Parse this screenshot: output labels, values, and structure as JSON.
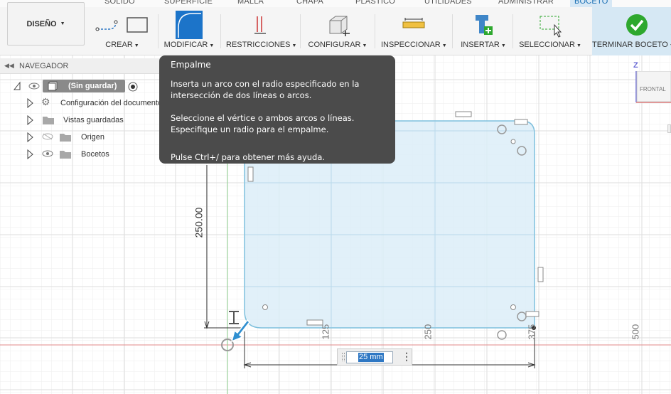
{
  "tabs": [
    {
      "label": "SÓLIDO"
    },
    {
      "label": "SUPERFICIE"
    },
    {
      "label": "MALLA"
    },
    {
      "label": "CHAPA"
    },
    {
      "label": "PLÁSTICO"
    },
    {
      "label": "UTILIDADES"
    },
    {
      "label": "ADMINISTRAR"
    },
    {
      "label": "BOCETO"
    }
  ],
  "toolbar": {
    "workspace": "DISEÑO",
    "groups": [
      {
        "label": "CREAR",
        "icon": "sketch-line-rectangle-icon"
      },
      {
        "label": "MODIFICAR",
        "icon": "fillet-icon"
      },
      {
        "label": "RESTRICCIONES",
        "icon": "constraint-icon"
      },
      {
        "label": "CONFIGURAR",
        "icon": "configure-icon"
      },
      {
        "label": "INSPECCIONAR",
        "icon": "measure-icon"
      },
      {
        "label": "INSERTAR",
        "icon": "insert-icon"
      },
      {
        "label": "SELECCIONAR",
        "icon": "select-icon"
      },
      {
        "label": "TERMINAR BOCETO",
        "icon": "finish-sketch-icon"
      }
    ]
  },
  "navigator": {
    "title": "NAVEGADOR",
    "root": "(Sin guardar)",
    "items": [
      {
        "label": "Configuración del documento"
      },
      {
        "label": "Vistas guardadas"
      },
      {
        "label": "Origen"
      },
      {
        "label": "Bocetos"
      }
    ]
  },
  "tooltip": {
    "title": "Empalme",
    "paragraph1": "Inserta un arco con el radio especificado en la intersección de dos líneas o arcos.",
    "paragraph2": "Seleccione el vértice o ambos arcos o líneas. Especifique un radio para el empalme.",
    "paragraph3": "Pulse Ctrl+/ para obtener más ayuda."
  },
  "canvas": {
    "vertical_dimension": "250.00",
    "axis_labels": [
      "125",
      "250",
      "375",
      "500"
    ],
    "radius_input": "25 mm"
  },
  "viewcube": {
    "axis": "Z",
    "face": "FRONTAL"
  },
  "colors": {
    "accent": "#2f78c4",
    "sketch_fill": "#d9ecf7",
    "sketch_stroke": "#7fbfdc",
    "tooltip_bg": "#4b4b4b",
    "finish_green": "#2ea82e"
  }
}
